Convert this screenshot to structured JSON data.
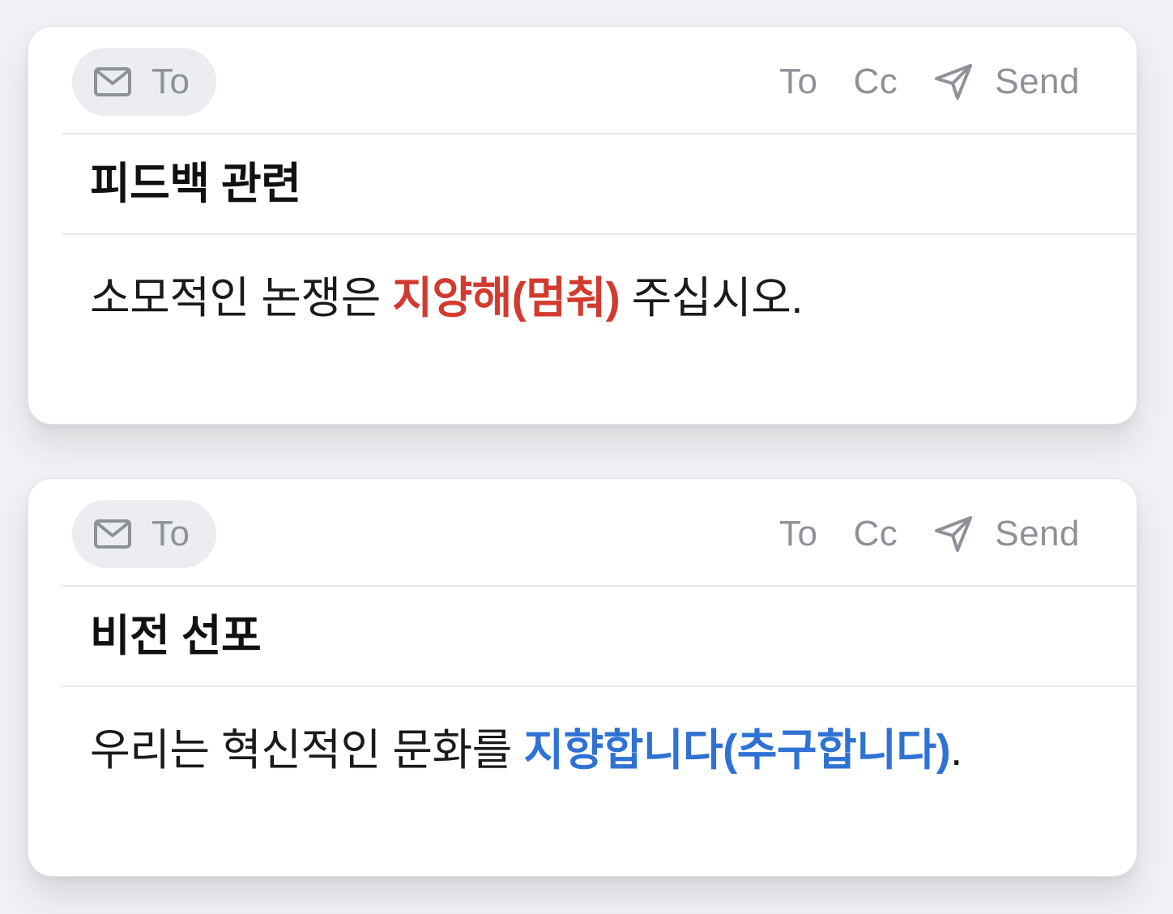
{
  "cards": [
    {
      "to_chip_label": "To",
      "actions": {
        "to": "To",
        "cc": "Cc",
        "send": "Send"
      },
      "subject": "피드백 관련",
      "body": {
        "before": "소모적인 논쟁은 ",
        "highlight": "지양해(멈춰)",
        "after": " 주십시오."
      },
      "highlight_color": "#d33a2f"
    },
    {
      "to_chip_label": "To",
      "actions": {
        "to": "To",
        "cc": "Cc",
        "send": "Send"
      },
      "subject": "비전 선포",
      "body": {
        "before": "우리는 혁신적인 문화를 ",
        "highlight": "지향합니다(추구합니다)",
        "after": "."
      },
      "highlight_color": "#2f72d4"
    }
  ],
  "icons": {
    "to_chip": "envelope-icon",
    "send": "paper-plane-icon"
  }
}
